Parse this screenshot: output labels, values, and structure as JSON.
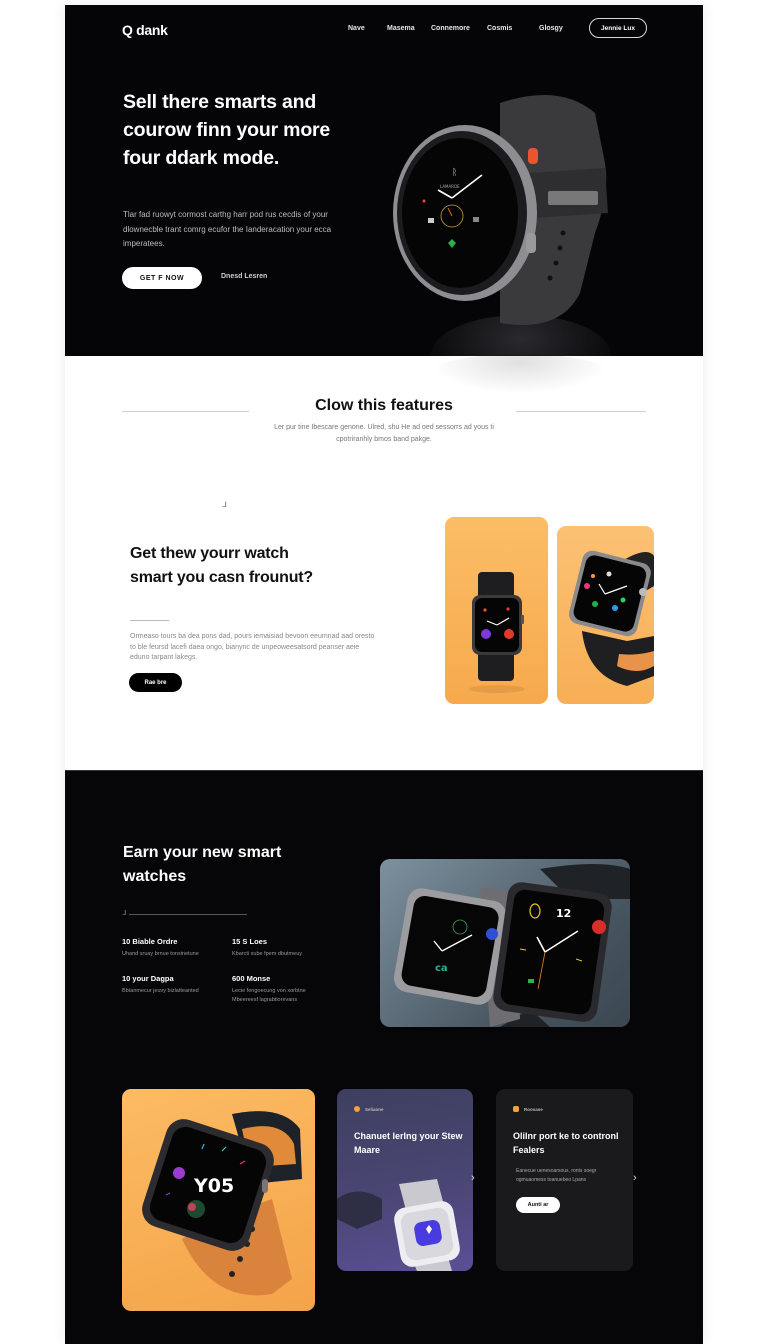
{
  "nav": {
    "logo": "Q dank",
    "links": [
      "Nave",
      "Masema",
      "Connemore",
      "Cosmis",
      "Glosgy"
    ],
    "cta": "Jennie Lux"
  },
  "hero": {
    "title": "Sell there smarts and courow finn your more four ddark mode.",
    "description": "Tlar fad ruowyt cormost carthg harr pod rus cecdis of your dlownecble trant comrg ecufor the Ianderacation your ecca imperatees.",
    "primary_button": "GET F NOW",
    "secondary_link": "Dnesd Lesren"
  },
  "features": {
    "title": "Clow this features",
    "subtitle": "Ler pur tine Ibescare genone. Ulred, shu He ad oed sessorrs ad yous ti cpotriranhly bmos band pakge.",
    "mark": "ᒧ",
    "promo": {
      "title": "Get thew yourr watch smart you casn frounut?",
      "description": "Ormeaso tours ba dea pons dad, pours iemaisiad bevoon eeumnad aad oresto to ble feursd lacefi daea ongo, bianync de unpeoweesatsord peanser aeie eduno tarpant lakegs.",
      "button": "Rae bre"
    }
  },
  "showcase": {
    "title": "Earn your new smart watches",
    "mark": "ᒧ",
    "stats": [
      {
        "title": "10 Biable Ordre",
        "desc": "Uhand sruay brnue tonsinetune"
      },
      {
        "title": "15 S Loes",
        "desc": "Kbarcti sube fpem dbutmeuy"
      },
      {
        "title": "10 your Dagpa",
        "desc": "Bbtanmecur jeuvy bizlatteanted"
      },
      {
        "title": "600 Monse",
        "desc": "Lecie fengoecung von xorbtne Mbeereesf lagrabtiorevans"
      }
    ]
  },
  "cards": {
    "purple": {
      "tag": "Seliaone",
      "title": "Chanuet lerlng your Stew Maare"
    },
    "black": {
      "tag": "Roovase",
      "title": "Olilnr port ke to contronl Fealers",
      "description": "Eanecue uenesoarsous, ronts soegr ogmuaomess toanuebeo Lpans",
      "button": "Aunti ar"
    },
    "big_watch_face": "Y05"
  },
  "colors": {
    "dark_bg": "#050507",
    "orange": "#f8ae55",
    "purple": "#4a4674",
    "accent_red": "#e84a2c"
  }
}
